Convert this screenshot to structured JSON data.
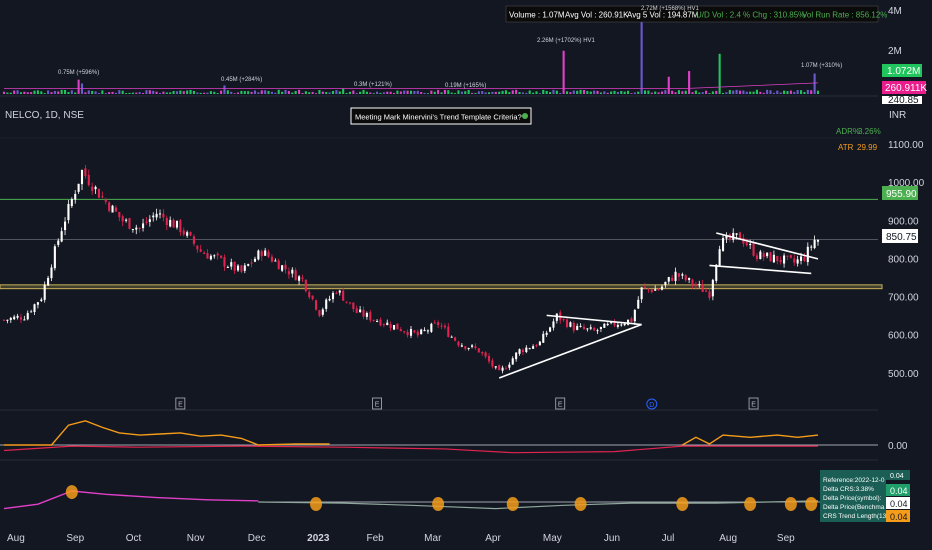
{
  "symbol_label": "NELCO, 1D, NSE",
  "currency": "INR",
  "criteria_label": "Meeting Mark Minervini's Trend Template Criteria?",
  "stats_bar": {
    "volume": "Volume : 1.07M",
    "avg_vol": "Avg Vol : 260.91K",
    "avg5": "Avg 5 Vol : 194.87M",
    "ud": "U/D Vol : 2.4",
    "chg": "% Chg : 310.85%",
    "runrate": "Vol Run Rate : 856.12%"
  },
  "volume_axis_labels": [
    "4M",
    "2M"
  ],
  "volume_pills": [
    {
      "text": "1.072M",
      "color": "#21c55d"
    },
    {
      "text": "260.911K",
      "color": "#e91e8c"
    },
    {
      "text": "240.85",
      "color": "#ffffff"
    }
  ],
  "volume_annotations": [
    "0.75M (+596%)",
    "0.45M (+284%)",
    "0.3M (+121%)",
    "0.19M (+165%)",
    "2.26M (+1702%) HV1",
    "1.07M (+310%)",
    "2.72M (+1568%) HV1"
  ],
  "adr_label": "ADR%",
  "adr_value": "3.26%",
  "atr_label": "ATR",
  "atr_value": "29.99",
  "price_level_green": "955.90",
  "price_level_current": "850.75",
  "osc_zero_label": "0.00",
  "earnings_marker": "E",
  "dividend_marker": "D",
  "crs_table": {
    "rows": [
      "Reference:2022-12-0",
      "Delta CRS:3.38%",
      "Delta Price(symbol):",
      "Delta Price(Benchma",
      "CRS Trend Length(13"
    ],
    "values": [
      "0.04",
      "0.04",
      "0.04"
    ],
    "header_value": "0.04"
  },
  "colors": {
    "background": "#131722",
    "up": "#ffffff",
    "down": "#e0244f",
    "green_line": "#4caf50",
    "yellow_band": "#c9b458",
    "orange": "#f59c1a",
    "magenta": "#e040c8",
    "grey_green": "#8fa89b"
  },
  "chart_data": {
    "type": "candlestick",
    "ylim": [
      480,
      1130
    ],
    "y_ticks": [
      1100,
      1000,
      900,
      800,
      700,
      600,
      500
    ],
    "x_labels": [
      "Aug",
      "Sep",
      "Oct",
      "Nov",
      "Dec",
      "2023",
      "Feb",
      "Mar",
      "Apr",
      "May",
      "Jun",
      "Jul",
      "Aug",
      "Sep"
    ],
    "levels": {
      "resistance": 955.9,
      "last": 850.75,
      "support_band": [
        722,
        732
      ]
    },
    "close_path": [
      {
        "i": 0,
        "p": 640
      },
      {
        "i": 6,
        "p": 650
      },
      {
        "i": 11,
        "p": 700
      },
      {
        "i": 17,
        "p": 880
      },
      {
        "i": 23,
        "p": 1030
      },
      {
        "i": 29,
        "p": 960
      },
      {
        "i": 35,
        "p": 900
      },
      {
        "i": 40,
        "p": 880
      },
      {
        "i": 45,
        "p": 920
      },
      {
        "i": 52,
        "p": 880
      },
      {
        "i": 58,
        "p": 820
      },
      {
        "i": 65,
        "p": 790
      },
      {
        "i": 70,
        "p": 765
      },
      {
        "i": 76,
        "p": 820
      },
      {
        "i": 82,
        "p": 780
      },
      {
        "i": 88,
        "p": 745
      },
      {
        "i": 93,
        "p": 660
      },
      {
        "i": 98,
        "p": 720
      },
      {
        "i": 104,
        "p": 660
      },
      {
        "i": 110,
        "p": 640
      },
      {
        "i": 116,
        "p": 620
      },
      {
        "i": 122,
        "p": 600
      },
      {
        "i": 128,
        "p": 630
      },
      {
        "i": 134,
        "p": 580
      },
      {
        "i": 140,
        "p": 560
      },
      {
        "i": 146,
        "p": 500
      },
      {
        "i": 152,
        "p": 560
      },
      {
        "i": 158,
        "p": 580
      },
      {
        "i": 163,
        "p": 650
      },
      {
        "i": 168,
        "p": 620
      },
      {
        "i": 174,
        "p": 610
      },
      {
        "i": 180,
        "p": 630
      },
      {
        "i": 185,
        "p": 640
      },
      {
        "i": 188,
        "p": 720
      },
      {
        "i": 193,
        "p": 720
      },
      {
        "i": 198,
        "p": 760
      },
      {
        "i": 204,
        "p": 730
      },
      {
        "i": 208,
        "p": 710
      },
      {
        "i": 211,
        "p": 840
      },
      {
        "i": 217,
        "p": 860
      },
      {
        "i": 222,
        "p": 810
      },
      {
        "i": 228,
        "p": 800
      },
      {
        "i": 233,
        "p": 790
      },
      {
        "i": 236,
        "p": 805
      },
      {
        "i": 239,
        "p": 850
      }
    ],
    "drawn_lines": [
      {
        "name": "uptrend-line-apr-jun",
        "from": {
          "i": 146,
          "p": 488
        },
        "to": {
          "i": 188,
          "p": 628
        }
      },
      {
        "name": "triangle-top-line",
        "from": {
          "i": 160,
          "p": 652
        },
        "to": {
          "i": 188,
          "p": 628
        }
      },
      {
        "name": "flag-upper-line",
        "from": {
          "i": 210,
          "p": 868
        },
        "to": {
          "i": 240,
          "p": 800
        }
      },
      {
        "name": "flag-lower-line",
        "from": {
          "i": 208,
          "p": 783
        },
        "to": {
          "i": 238,
          "p": 762
        }
      }
    ],
    "volume": {
      "ylim": [
        0,
        4.6
      ],
      "spikes": [
        {
          "i": 22,
          "v": 0.75
        },
        {
          "i": 23,
          "v": 0.55
        },
        {
          "i": 65,
          "v": 0.45
        },
        {
          "i": 100,
          "v": 0.3
        },
        {
          "i": 134,
          "v": 0.19
        },
        {
          "i": 165,
          "v": 2.26
        },
        {
          "i": 188,
          "v": 4.3
        },
        {
          "i": 196,
          "v": 0.9
        },
        {
          "i": 202,
          "v": 1.2
        },
        {
          "i": 211,
          "v": 2.1
        },
        {
          "i": 239,
          "v": 1.07
        }
      ]
    },
    "markers": [
      {
        "i": 52,
        "type": "E"
      },
      {
        "i": 110,
        "type": "E"
      },
      {
        "i": 164,
        "type": "E"
      },
      {
        "i": 191,
        "type": "D"
      },
      {
        "i": 221,
        "type": "E"
      }
    ],
    "oscillator1": {
      "orange": [
        {
          "i": 0,
          "v": 0.0
        },
        {
          "i": 14,
          "v": 0.0
        },
        {
          "i": 19,
          "v": 0.9
        },
        {
          "i": 24,
          "v": 1.1
        },
        {
          "i": 29,
          "v": 0.8
        },
        {
          "i": 34,
          "v": 0.55
        },
        {
          "i": 40,
          "v": 0.45
        },
        {
          "i": 46,
          "v": 0.5
        },
        {
          "i": 52,
          "v": 0.55
        },
        {
          "i": 58,
          "v": 0.4
        },
        {
          "i": 64,
          "v": 0.45
        },
        {
          "i": 70,
          "v": 0.3
        },
        {
          "i": 75,
          "v": 0.0
        },
        {
          "i": 86,
          "v": 0.05
        },
        {
          "i": 96,
          "v": 0.05
        }
      ],
      "magenta": [
        {
          "i": 0,
          "v": -0.25
        },
        {
          "i": 20,
          "v": -0.05
        },
        {
          "i": 40,
          "v": -0.1
        },
        {
          "i": 70,
          "v": -0.05
        },
        {
          "i": 100,
          "v": -0.1
        },
        {
          "i": 130,
          "v": -0.18
        },
        {
          "i": 150,
          "v": -0.35
        },
        {
          "i": 180,
          "v": -0.3
        },
        {
          "i": 200,
          "v": -0.05
        },
        {
          "i": 215,
          "v": -0.05
        },
        {
          "i": 240,
          "v": -0.05
        }
      ],
      "orange2": [
        {
          "i": 200,
          "v": 0.0
        },
        {
          "i": 204,
          "v": 0.35
        },
        {
          "i": 208,
          "v": 0.05
        },
        {
          "i": 212,
          "v": 0.45
        },
        {
          "i": 220,
          "v": 0.35
        },
        {
          "i": 228,
          "v": 0.45
        },
        {
          "i": 234,
          "v": 0.35
        },
        {
          "i": 240,
          "v": 0.45
        }
      ]
    },
    "oscillator2": {
      "magenta": [
        {
          "i": 0,
          "v": -0.3
        },
        {
          "i": 10,
          "v": -0.1
        },
        {
          "i": 20,
          "v": 0.5
        },
        {
          "i": 30,
          "v": 0.35
        },
        {
          "i": 45,
          "v": 0.2
        },
        {
          "i": 60,
          "v": 0.1
        },
        {
          "i": 75,
          "v": 0.05
        }
      ],
      "grey_green": [
        {
          "i": 75,
          "v": 0.0
        },
        {
          "i": 100,
          "v": -0.05
        },
        {
          "i": 120,
          "v": -0.15
        },
        {
          "i": 145,
          "v": -0.3
        },
        {
          "i": 165,
          "v": -0.15
        },
        {
          "i": 185,
          "v": -0.05
        },
        {
          "i": 210,
          "v": -0.05
        },
        {
          "i": 240,
          "v": 0.05
        }
      ],
      "dots": [
        20,
        92,
        128,
        150,
        170,
        200,
        220,
        232,
        238
      ]
    }
  }
}
